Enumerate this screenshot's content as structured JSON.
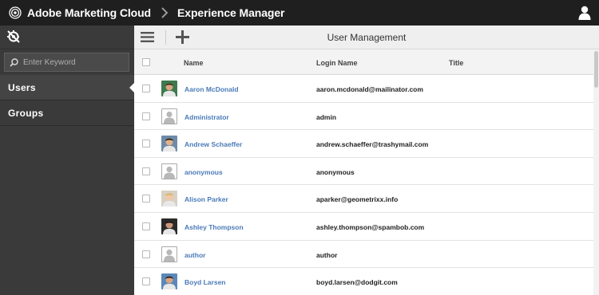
{
  "header": {
    "brand": "Adobe Marketing Cloud",
    "product": "Experience Manager"
  },
  "sidebar": {
    "search_placeholder": "Enter Keyword",
    "items": [
      {
        "label": "Users",
        "active": true
      },
      {
        "label": "Groups",
        "active": false
      }
    ]
  },
  "toolbar": {
    "title": "User Management"
  },
  "table": {
    "columns": [
      "Name",
      "Login Name",
      "Title"
    ],
    "rows": [
      {
        "name": "Aaron McDonald",
        "login": "aaron.mcdonald@mailinator.com",
        "title": "",
        "avatar": "photo"
      },
      {
        "name": "Administrator",
        "login": "admin",
        "title": "",
        "avatar": "placeholder"
      },
      {
        "name": "Andrew Schaeffer",
        "login": "andrew.schaeffer@trashymail.com",
        "title": "",
        "avatar": "photo"
      },
      {
        "name": "anonymous",
        "login": "anonymous",
        "title": "",
        "avatar": "placeholder"
      },
      {
        "name": "Alison Parker",
        "login": "aparker@geometrixx.info",
        "title": "",
        "avatar": "photo"
      },
      {
        "name": "Ashley Thompson",
        "login": "ashley.thompson@spambob.com",
        "title": "",
        "avatar": "photo"
      },
      {
        "name": "author",
        "login": "author",
        "title": "",
        "avatar": "placeholder"
      },
      {
        "name": "Boyd Larsen",
        "login": "boyd.larsen@dodgit.com",
        "title": "",
        "avatar": "photo"
      }
    ]
  },
  "colors": {
    "topbar": "#1f1f1f",
    "sidebar": "#3a3a3a",
    "link": "#4a7bb8"
  }
}
